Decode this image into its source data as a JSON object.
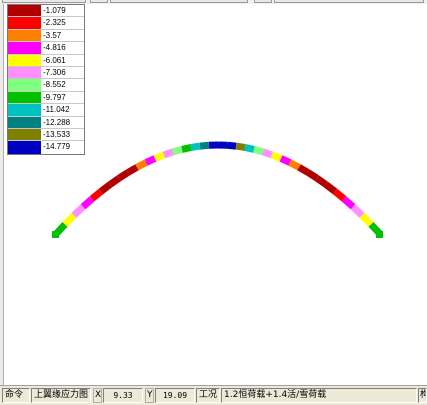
{
  "legend": {
    "items": [
      {
        "color": "#b00000",
        "label": "-1.079"
      },
      {
        "color": "#ff0000",
        "label": "-2.325"
      },
      {
        "color": "#ff8000",
        "label": "-3.57"
      },
      {
        "color": "#ff00ff",
        "label": "-4.816"
      },
      {
        "color": "#ffff00",
        "label": "-6.061"
      },
      {
        "color": "#ff90ff",
        "label": "-7.306"
      },
      {
        "color": "#80ff80",
        "label": "-8.552"
      },
      {
        "color": "#00c000",
        "label": "-9.797"
      },
      {
        "color": "#00c0c0",
        "label": "-11.042"
      },
      {
        "color": "#008080",
        "label": "-12.288"
      },
      {
        "color": "#808000",
        "label": "-13.533"
      },
      {
        "color": "#0000c0",
        "label": "-14.779"
      }
    ]
  },
  "arch_segments": [
    "#00c000",
    "#ffff00",
    "#ff90ff",
    "#ff00ff",
    "#ff0000",
    "#b00000",
    "#b00000",
    "#b00000",
    "#b00000",
    "#ff8000",
    "#ff00ff",
    "#ffff00",
    "#ff90ff",
    "#80ff80",
    "#00c000",
    "#00c0c0",
    "#008080",
    "#0000c0",
    "#0000c0",
    "#0000c0",
    "#808000",
    "#00c0c0",
    "#80ff80",
    "#ff90ff",
    "#ffff00",
    "#ff00ff",
    "#ff8000",
    "#b00000",
    "#b00000",
    "#b00000",
    "#b00000",
    "#ff0000",
    "#ff00ff",
    "#ff90ff",
    "#ffff00",
    "#00c000"
  ],
  "statusbar": {
    "command_label": "命令",
    "view_name": "上翼缘应力图",
    "x_label": "X",
    "x_value": "9.33",
    "y_label": "Y",
    "y_value": "19.09",
    "case_label": "工况",
    "case_value": "1.2恒荷载+1.4活/雪荷载",
    "extra_label": "构"
  }
}
